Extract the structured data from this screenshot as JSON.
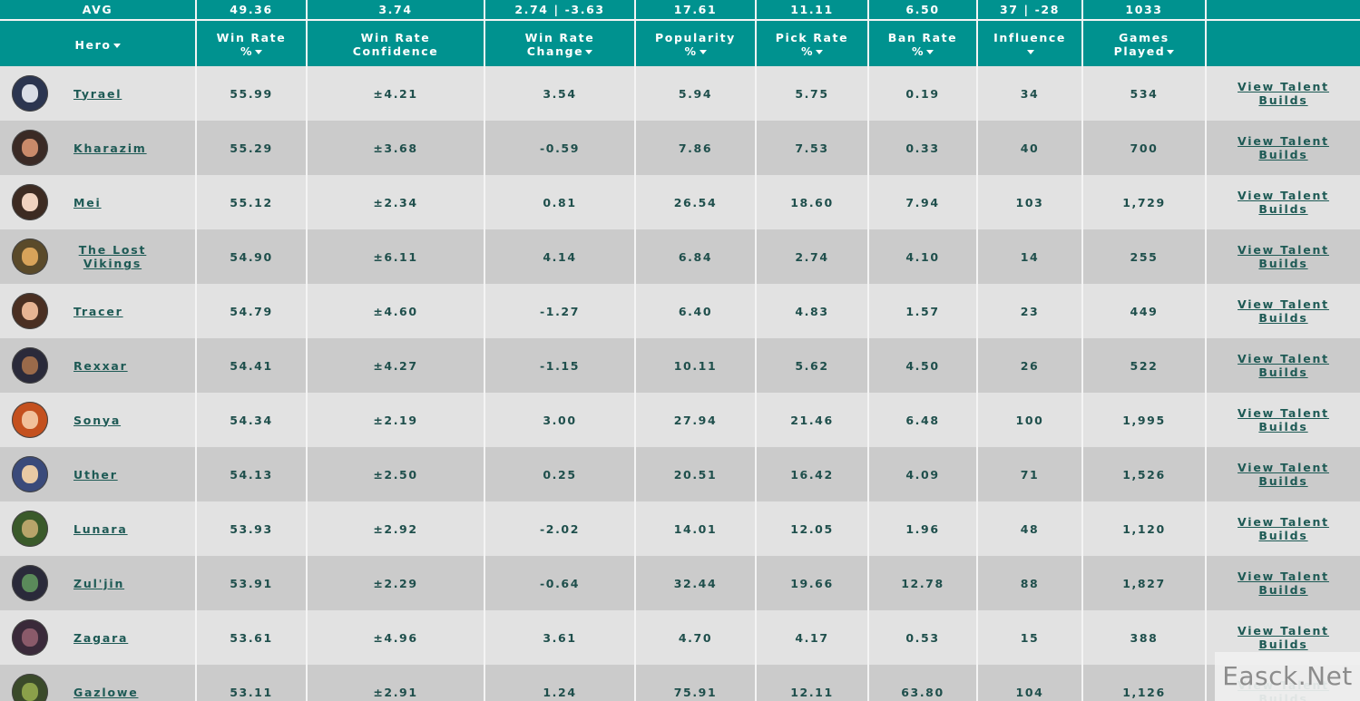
{
  "avg": {
    "label": "AVG",
    "win_rate": "49.36",
    "win_rate_confidence": "3.74",
    "win_rate_change": "2.74 | -3.63",
    "popularity": "17.61",
    "pick_rate": "11.11",
    "ban_rate": "6.50",
    "influence": "37 | -28",
    "games_played": "1033"
  },
  "headers": {
    "hero": "Hero",
    "win_rate_l1": "Win Rate",
    "win_rate_l2": "%",
    "confidence_l1": "Win Rate",
    "confidence_l2": "Confidence",
    "change_l1": "Win Rate",
    "change_l2": "Change",
    "popularity_l1": "Popularity",
    "popularity_l2": "%",
    "pick_l1": "Pick Rate",
    "pick_l2": "%",
    "ban_l1": "Ban Rate",
    "ban_l2": "%",
    "influence_l1": "Influence",
    "games_l1": "Games",
    "games_l2": "Played"
  },
  "talent_label_l1": "View Talent",
  "talent_label_l2": "Builds",
  "rows": [
    {
      "hero": "Tyrael",
      "hero_l1": "",
      "hero_l2": "",
      "win_rate": "55.99",
      "confidence": "±4.21",
      "change": "3.54",
      "popularity": "5.94",
      "pick_rate": "5.75",
      "ban_rate": "0.19",
      "influence": "34",
      "games": "534",
      "avatar_bg": "#2b3550",
      "avatar_face": "#d9dde6"
    },
    {
      "hero": "Kharazim",
      "hero_l1": "",
      "hero_l2": "",
      "win_rate": "55.29",
      "confidence": "±3.68",
      "change": "-0.59",
      "popularity": "7.86",
      "pick_rate": "7.53",
      "ban_rate": "0.33",
      "influence": "40",
      "games": "700",
      "avatar_bg": "#3a2a25",
      "avatar_face": "#c98a6a"
    },
    {
      "hero": "Mei",
      "hero_l1": "",
      "hero_l2": "",
      "win_rate": "55.12",
      "confidence": "±2.34",
      "change": "0.81",
      "popularity": "26.54",
      "pick_rate": "18.60",
      "ban_rate": "7.94",
      "influence": "103",
      "games": "1,729",
      "avatar_bg": "#3d2b22",
      "avatar_face": "#f0d2bf"
    },
    {
      "hero": "",
      "hero_l1": "The Lost",
      "hero_l2": "Vikings",
      "win_rate": "54.90",
      "confidence": "±6.11",
      "change": "4.14",
      "popularity": "6.84",
      "pick_rate": "2.74",
      "ban_rate": "4.10",
      "influence": "14",
      "games": "255",
      "avatar_bg": "#5a4a2a",
      "avatar_face": "#d8a35a"
    },
    {
      "hero": "Tracer",
      "hero_l1": "",
      "hero_l2": "",
      "win_rate": "54.79",
      "confidence": "±4.60",
      "change": "-1.27",
      "popularity": "6.40",
      "pick_rate": "4.83",
      "ban_rate": "1.57",
      "influence": "23",
      "games": "449",
      "avatar_bg": "#4a2f22",
      "avatar_face": "#e7b493"
    },
    {
      "hero": "Rexxar",
      "hero_l1": "",
      "hero_l2": "",
      "win_rate": "54.41",
      "confidence": "±4.27",
      "change": "-1.15",
      "popularity": "10.11",
      "pick_rate": "5.62",
      "ban_rate": "4.50",
      "influence": "26",
      "games": "522",
      "avatar_bg": "#2a2a3a",
      "avatar_face": "#9a6a4a"
    },
    {
      "hero": "Sonya",
      "hero_l1": "",
      "hero_l2": "",
      "win_rate": "54.34",
      "confidence": "±2.19",
      "change": "3.00",
      "popularity": "27.94",
      "pick_rate": "21.46",
      "ban_rate": "6.48",
      "influence": "100",
      "games": "1,995",
      "avatar_bg": "#c4501e",
      "avatar_face": "#f1c09a"
    },
    {
      "hero": "Uther",
      "hero_l1": "",
      "hero_l2": "",
      "win_rate": "54.13",
      "confidence": "±2.50",
      "change": "0.25",
      "popularity": "20.51",
      "pick_rate": "16.42",
      "ban_rate": "4.09",
      "influence": "71",
      "games": "1,526",
      "avatar_bg": "#3a4a7a",
      "avatar_face": "#e8c9a4"
    },
    {
      "hero": "Lunara",
      "hero_l1": "",
      "hero_l2": "",
      "win_rate": "53.93",
      "confidence": "±2.92",
      "change": "-2.02",
      "popularity": "14.01",
      "pick_rate": "12.05",
      "ban_rate": "1.96",
      "influence": "48",
      "games": "1,120",
      "avatar_bg": "#3a5a2a",
      "avatar_face": "#b8a46a"
    },
    {
      "hero": "Zul'jin",
      "hero_l1": "",
      "hero_l2": "",
      "win_rate": "53.91",
      "confidence": "±2.29",
      "change": "-0.64",
      "popularity": "32.44",
      "pick_rate": "19.66",
      "ban_rate": "12.78",
      "influence": "88",
      "games": "1,827",
      "avatar_bg": "#2a2a3a",
      "avatar_face": "#5a8a5a"
    },
    {
      "hero": "Zagara",
      "hero_l1": "",
      "hero_l2": "",
      "win_rate": "53.61",
      "confidence": "±4.96",
      "change": "3.61",
      "popularity": "4.70",
      "pick_rate": "4.17",
      "ban_rate": "0.53",
      "influence": "15",
      "games": "388",
      "avatar_bg": "#3a2a3a",
      "avatar_face": "#8a5a6a"
    },
    {
      "hero": "Gazlowe",
      "hero_l1": "",
      "hero_l2": "",
      "win_rate": "53.11",
      "confidence": "±2.91",
      "change": "1.24",
      "popularity": "75.91",
      "pick_rate": "12.11",
      "ban_rate": "63.80",
      "influence": "104",
      "games": "1,126",
      "avatar_bg": "#3a4a2a",
      "avatar_face": "#8aa04a"
    }
  ],
  "watermark": "Easck.Net"
}
